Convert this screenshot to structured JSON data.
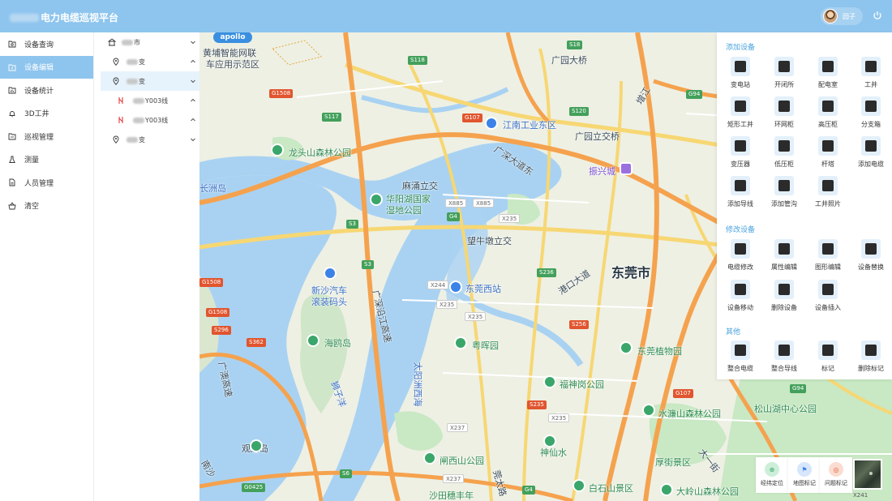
{
  "header": {
    "title": "电力电缆巡视平台",
    "user_name": "园子",
    "power_icon": "power-icon",
    "bg_color": "#8ec5ee"
  },
  "sidebar": {
    "items": [
      {
        "label": "设备查询",
        "icon": "folder-search-icon",
        "active": false
      },
      {
        "label": "设备编辑",
        "icon": "folder-edit-icon",
        "active": true
      },
      {
        "label": "设备统计",
        "icon": "folder-chart-icon",
        "active": false
      },
      {
        "label": "3D工井",
        "icon": "bell-icon",
        "active": false
      },
      {
        "label": "巡视管理",
        "icon": "folder-manage-icon",
        "active": false
      },
      {
        "label": "测量",
        "icon": "flask-icon",
        "active": false
      },
      {
        "label": "人员管理",
        "icon": "document-icon",
        "active": false
      },
      {
        "label": "清空",
        "icon": "basket-icon",
        "active": false
      }
    ]
  },
  "tree": {
    "rows": [
      {
        "label": "市",
        "icon": "building-icon",
        "expanded": false
      },
      {
        "label": "变",
        "icon": "location-pin-icon",
        "expanded": true
      },
      {
        "label": "变",
        "icon": "location-pin-icon",
        "expanded": false,
        "selected": true
      },
      {
        "label": "Y003线",
        "icon": "cable-line-icon",
        "expanded": true
      },
      {
        "label": "Y003线",
        "icon": "cable-line-icon",
        "expanded": true
      },
      {
        "label": "变",
        "icon": "location-pin-icon",
        "expanded": false
      }
    ]
  },
  "map": {
    "logo": "apollo",
    "labels": {
      "huangpu": "黄埔智能网联",
      "huangpu2": "车应用示范区",
      "guangyuan_bridge": "广园大桥",
      "jiangnan": "江南工业东区",
      "guangyuan_lijiao": "广园立交桥",
      "longtou": "龙头山森林公园",
      "guangshen": "广深大道东",
      "zhenxing": "振兴城",
      "changzhou": "长洲岛",
      "mayong": "麻涌立交",
      "huayang": "华阳湖国家",
      "huayang2": "湿地公园",
      "wangniudun": "望牛墩立交",
      "dongguan": "东莞市",
      "xinsha": "新沙汽车",
      "xinsha2": "滚装码头",
      "guangshen_yanjiang": "广深沿江高速",
      "dongguan_west": "东莞西站",
      "gangkou": "港口大道",
      "haiou": "海鸥岛",
      "yuehui": "粤晖园",
      "taiyangzhou": "太阳洲西海",
      "shizijiang": "狮子洋",
      "guangao": "广澳高速",
      "zhiwuyuan": "东莞植物园",
      "fushen": "福神岗公园",
      "shuilian": "水濂山森林公园",
      "songshanhu": "松山湖中心公园",
      "guanlong": "观龙岛",
      "shenxianshui": "神仙水",
      "houjie": "厚街景区",
      "taiyi": "大一街",
      "naxishan": "闸西山公园",
      "guantai": "莞太路",
      "baishi": "白石山景区",
      "daling": "大岭山森林公园",
      "shatian": "沙田穗丰年",
      "nansha": "南沙",
      "zengjiang": "增江"
    },
    "road_codes": [
      "S18",
      "S118",
      "S117",
      "G1508",
      "G107",
      "S120",
      "G94",
      "X885",
      "X885",
      "G4",
      "S3",
      "X235",
      "S236",
      "S3",
      "G1508",
      "G1508",
      "S296",
      "S362",
      "X244",
      "X235",
      "X235",
      "S256",
      "G107",
      "S235",
      "X235",
      "X237",
      "X237",
      "S6",
      "G0425",
      "G4",
      "G94",
      "X241"
    ]
  },
  "tools": {
    "add_title": "添加设备",
    "add": [
      {
        "label": "变电站",
        "icon": "substation-icon"
      },
      {
        "label": "开闭所",
        "icon": "switch-station-icon"
      },
      {
        "label": "配电室",
        "icon": "distribution-room-icon"
      },
      {
        "label": "工井",
        "icon": "well-icon"
      },
      {
        "label": "矩形工井",
        "icon": "rect-well-icon"
      },
      {
        "label": "环网柜",
        "icon": "ring-cabinet-icon"
      },
      {
        "label": "高压柜",
        "icon": "hv-cabinet-icon"
      },
      {
        "label": "分支箱",
        "icon": "branch-box-icon"
      },
      {
        "label": "变压器",
        "icon": "transformer-icon"
      },
      {
        "label": "低压柜",
        "icon": "lv-cabinet-icon"
      },
      {
        "label": "杆塔",
        "icon": "tower-icon"
      },
      {
        "label": "添加电缆",
        "icon": "cable-icon"
      },
      {
        "label": "添加导线",
        "icon": "wire-icon"
      },
      {
        "label": "添加管沟",
        "icon": "trench-icon"
      },
      {
        "label": "工井照片",
        "icon": "photo-icon"
      }
    ],
    "modify_title": "修改设备",
    "modify": [
      {
        "label": "电缆修改",
        "icon": "pen-icon"
      },
      {
        "label": "属性编辑",
        "icon": "copy-icon"
      },
      {
        "label": "图形编辑",
        "icon": "shapes-icon"
      },
      {
        "label": "设备替换",
        "icon": "swap-icon"
      },
      {
        "label": "设备移动",
        "icon": "phone-move-icon"
      },
      {
        "label": "删除设备",
        "icon": "delete-icon"
      },
      {
        "label": "设备插入",
        "icon": "insert-icon"
      }
    ],
    "other_title": "其他",
    "other": [
      {
        "label": "整合电缆",
        "icon": "merge-cable-icon"
      },
      {
        "label": "整合导线",
        "icon": "merge-wire-icon"
      },
      {
        "label": "标记",
        "icon": "tag-icon"
      },
      {
        "label": "删除标记",
        "icon": "tag-delete-icon"
      }
    ]
  },
  "float_buttons": [
    {
      "label": "经纬定位",
      "icon": "crosshair-icon",
      "color": "#3aa66a"
    },
    {
      "label": "地图标记",
      "icon": "flag-icon",
      "color": "#3c83e8"
    },
    {
      "label": "问题标记",
      "icon": "warning-icon",
      "color": "#e5603b"
    }
  ],
  "map_code": "X241"
}
